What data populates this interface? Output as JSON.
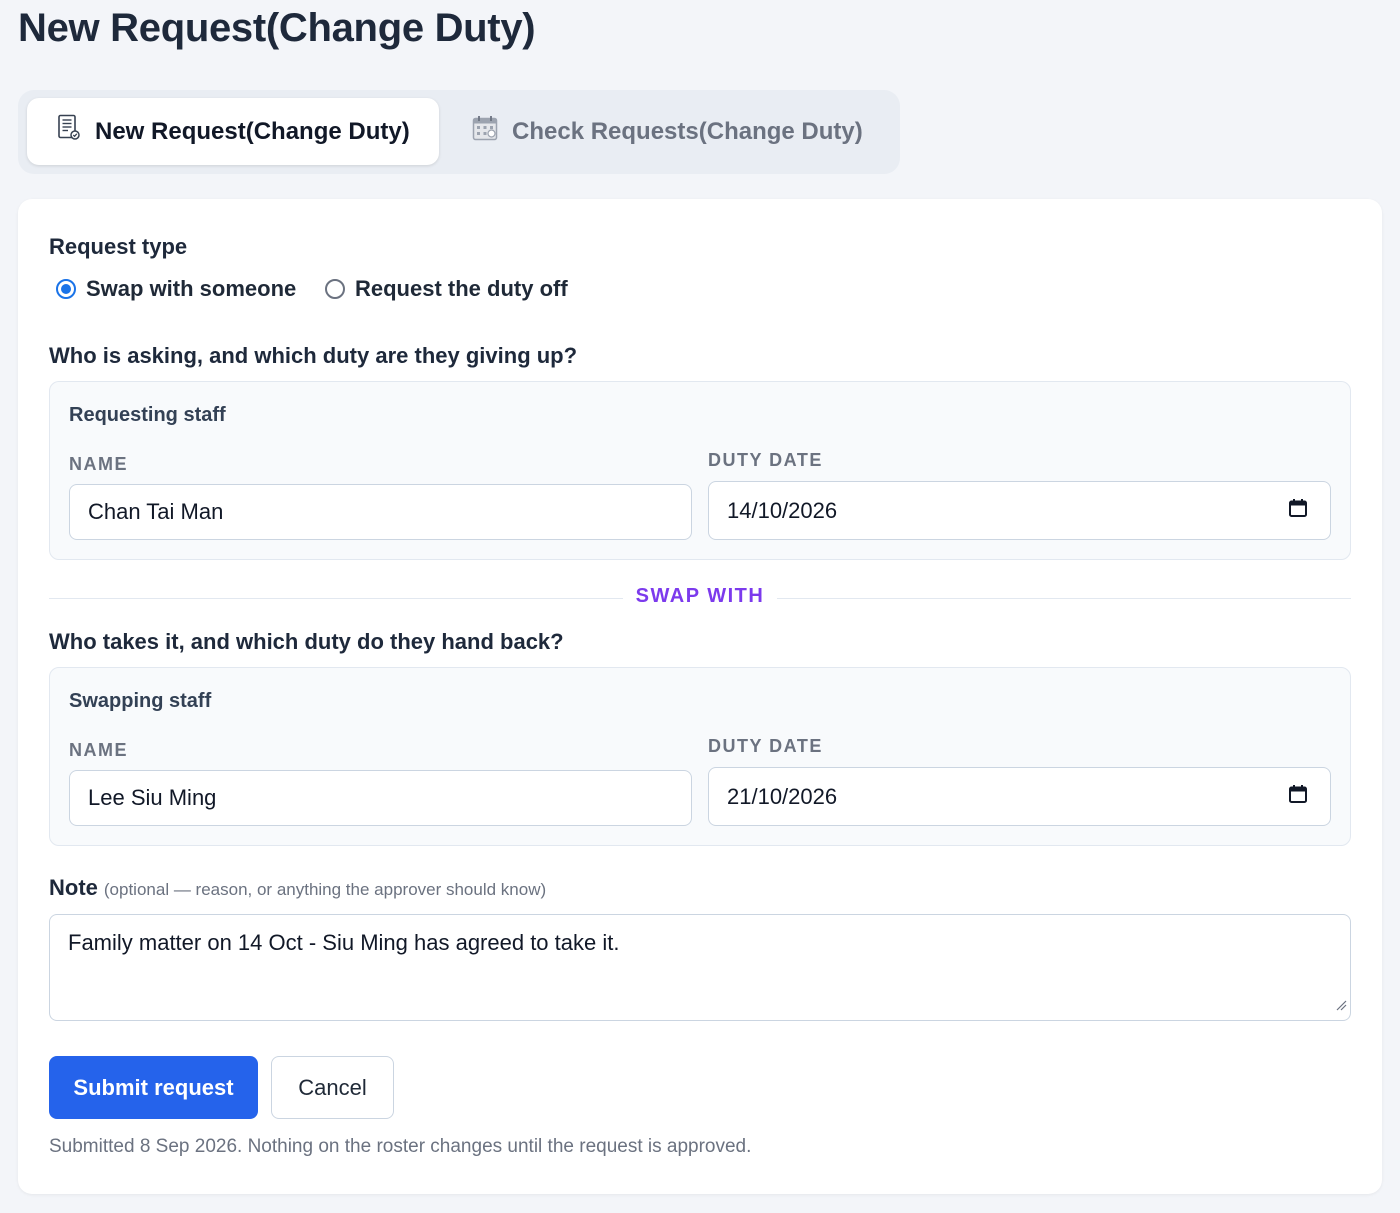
{
  "page": {
    "title": "New Request(Change Duty)"
  },
  "tabs": [
    {
      "label": "New Request(Change Duty)",
      "icon": "document-icon",
      "active": true
    },
    {
      "label": "Check Requests(Change Duty)",
      "icon": "calendar-icon",
      "active": false
    }
  ],
  "form": {
    "request_type": {
      "label": "Request type",
      "options": [
        {
          "label": "Swap with someone",
          "selected": true
        },
        {
          "label": "Request the duty off",
          "selected": false
        }
      ]
    },
    "requester_section": {
      "question": "Who is asking, and which duty are they giving up?",
      "group_title": "Requesting staff",
      "name_label": "NAME",
      "name_value": "Chan Tai Man",
      "date_label": "DUTY DATE",
      "date_value": "14/10/2026"
    },
    "divider_label": "SWAP WITH",
    "swapper_section": {
      "question": "Who takes it, and which duty do they hand back?",
      "group_title": "Swapping staff",
      "name_label": "NAME",
      "name_value": "Lee Siu Ming",
      "date_label": "DUTY DATE",
      "date_value": "21/10/2026"
    },
    "note": {
      "label": "Note",
      "hint": "(optional — reason, or anything the approver should know)",
      "value": "Family matter on 14 Oct - Siu Ming has agreed to take it."
    },
    "buttons": {
      "submit": "Submit request",
      "cancel": "Cancel"
    },
    "footnote": "Submitted 8 Sep 2026. Nothing on the roster changes until the request is approved."
  },
  "colors": {
    "accent": "#2563eb",
    "radio_checked": "#1a73e8",
    "divider_label": "#7c3aed",
    "background": "#f3f5f9"
  }
}
